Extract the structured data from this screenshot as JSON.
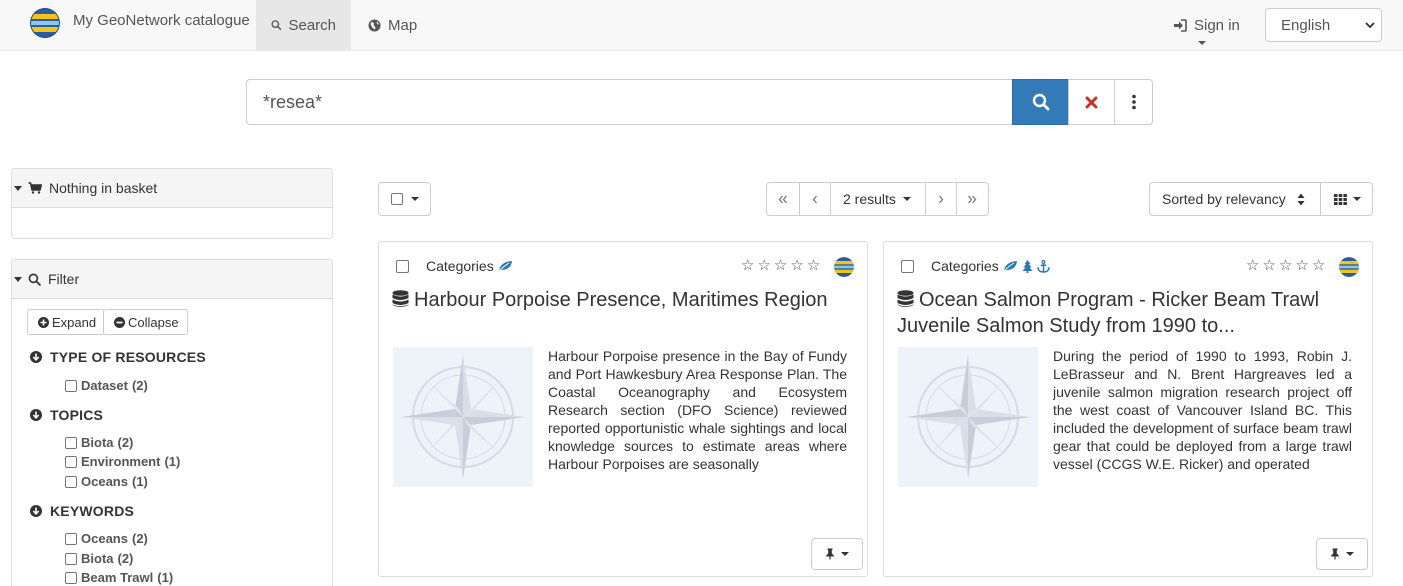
{
  "navbar": {
    "brand_title": "My GeoNetwork catalogue",
    "tabs": [
      {
        "label": "Search",
        "icon": "search-icon",
        "active": true
      },
      {
        "label": "Map",
        "icon": "globe-icon",
        "active": false
      }
    ],
    "signin_label": "Sign in",
    "language": "English"
  },
  "search": {
    "query": "*resea*"
  },
  "sidebar": {
    "basket_label": "Nothing in basket",
    "filter_label": "Filter",
    "expand_label": "Expand",
    "collapse_label": "Collapse",
    "facets": [
      {
        "title": "TYPE OF RESOURCES",
        "items": [
          {
            "label": "Dataset",
            "count": "(2)"
          }
        ]
      },
      {
        "title": "TOPICS",
        "items": [
          {
            "label": "Biota",
            "count": "(2)"
          },
          {
            "label": "Environment",
            "count": "(1)"
          },
          {
            "label": "Oceans",
            "count": "(1)"
          }
        ]
      },
      {
        "title": "KEYWORDS",
        "items": [
          {
            "label": "Oceans",
            "count": "(2)"
          },
          {
            "label": "Biota",
            "count": "(2)"
          },
          {
            "label": "Beam Trawl",
            "count": "(1)"
          }
        ]
      }
    ]
  },
  "toolbar": {
    "results_label": "2 results",
    "sort_label": "Sorted by relevancy"
  },
  "results": [
    {
      "categories_label": "Categories",
      "category_icons": [
        "leaf-icon"
      ],
      "title": "Harbour Porpoise Presence, Maritimes Region",
      "abstract": "Harbour Porpoise presence in the Bay of Fundy and Port Hawkesbury Area Response Plan. The Coastal Oceanography and Ecosystem Research section (DFO Science) reviewed reported opportunistic whale sightings and local knowledge sources to estimate areas where Harbour Porpoises are seasonally",
      "rating": 0
    },
    {
      "categories_label": "Categories",
      "category_icons": [
        "leaf-icon",
        "tree-icon",
        "anchor-icon"
      ],
      "title": "Ocean Salmon Program - Ricker Beam Trawl Juvenile Salmon Study from 1990 to...",
      "abstract": "During the period of 1990 to 1993, Robin J. LeBrasseur and N. Brent Hargreaves led a juvenile salmon migration research project off the west coast of Vancouver Island BC. This included the development of surface beam trawl gear that could be deployed from a large trawl vessel (CCGS W.E. Ricker) and operated",
      "rating": 0
    }
  ],
  "colors": {
    "primary": "#337ab7",
    "danger": "#c9302c",
    "category_icon": "#2a7ab0"
  }
}
